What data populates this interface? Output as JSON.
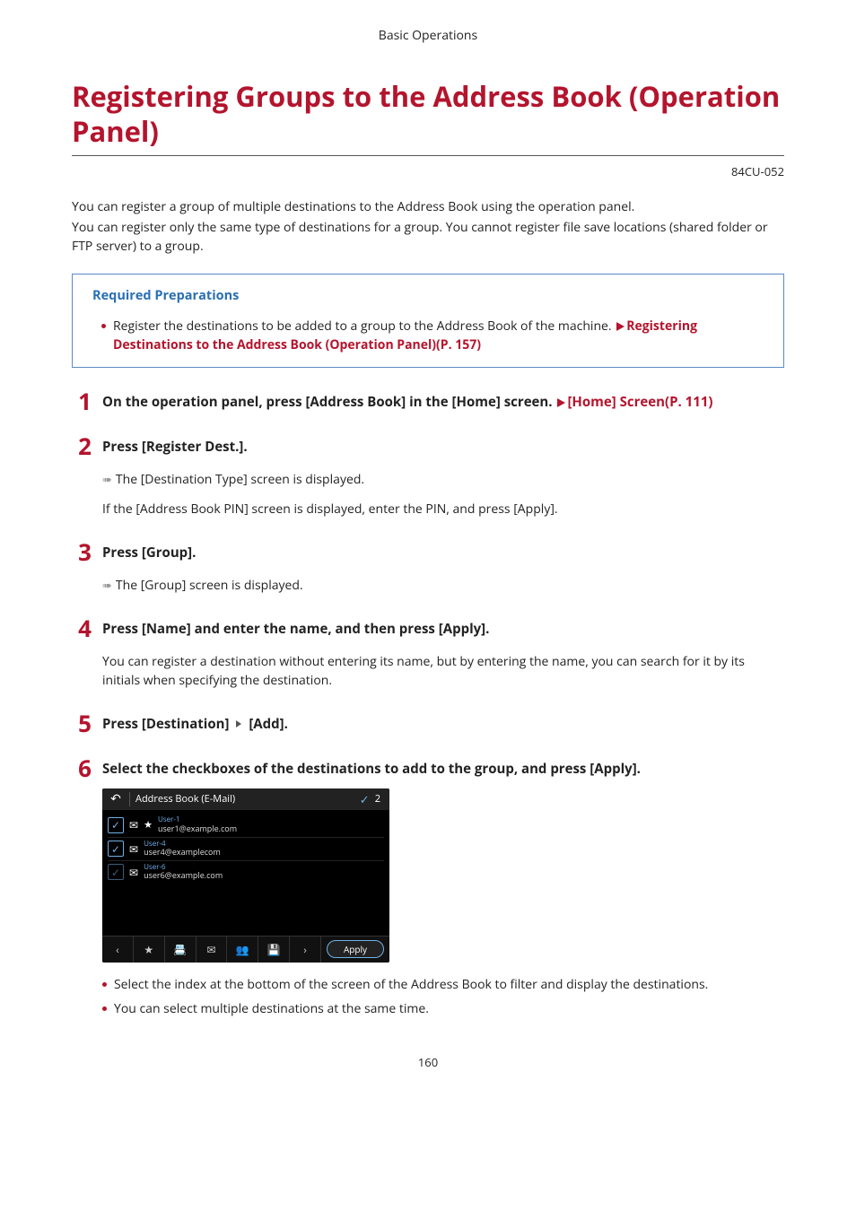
{
  "header": {
    "section": "Basic Operations"
  },
  "title": "Registering Groups to the Address Book (Operation Panel)",
  "doc_code": "84CU-052",
  "intro": {
    "p1": "You can register a group of multiple destinations to the Address Book using the operation panel.",
    "p2": "You can register only the same type of destinations for a group. You cannot register file save locations (shared folder or FTP server) to a group."
  },
  "prep": {
    "title": "Required Preparations",
    "item_pre": "Register the destinations to be added to a group to the Address Book of the machine. ",
    "item_link": "Registering Destinations to the Address Book (Operation Panel)(P. 157)"
  },
  "steps": {
    "s1": {
      "num": "1",
      "title_pre": "On the operation panel, press [Address Book] in the [Home] screen. ",
      "title_link": "[Home] Screen(P. 111)"
    },
    "s2": {
      "num": "2",
      "title": "Press [Register Dest.].",
      "result": "The [Destination Type] screen is displayed.",
      "note": "If the [Address Book PIN] screen is displayed, enter the PIN, and press [Apply]."
    },
    "s3": {
      "num": "3",
      "title": "Press [Group].",
      "result": "The [Group] screen is displayed."
    },
    "s4": {
      "num": "4",
      "title": "Press [Name] and enter the name, and then press [Apply].",
      "note": "You can register a destination without entering its name, but by entering the name, you can search for it by its initials when specifying the destination."
    },
    "s5": {
      "num": "5",
      "title_a": "Press [Destination]",
      "title_b": "[Add]."
    },
    "s6": {
      "num": "6",
      "title": "Select the checkboxes of the destinations to add to the group, and press [Apply].",
      "bullet1": "Select the index at the bottom of the screen of the Address Book to filter and display the destinations.",
      "bullet2": "You can select multiple destinations at the same time."
    }
  },
  "device": {
    "title": "Address Book (E-Mail)",
    "count": "2",
    "rows": [
      {
        "name": "User-1",
        "email": "user1@example.com",
        "checked": true,
        "star": true
      },
      {
        "name": "User-4",
        "email": "user4@examplecom",
        "checked": true,
        "star": false
      },
      {
        "name": "User-6",
        "email": "user6@example.com",
        "checked": false,
        "star": false
      }
    ],
    "apply": "Apply"
  },
  "page_number": "160"
}
